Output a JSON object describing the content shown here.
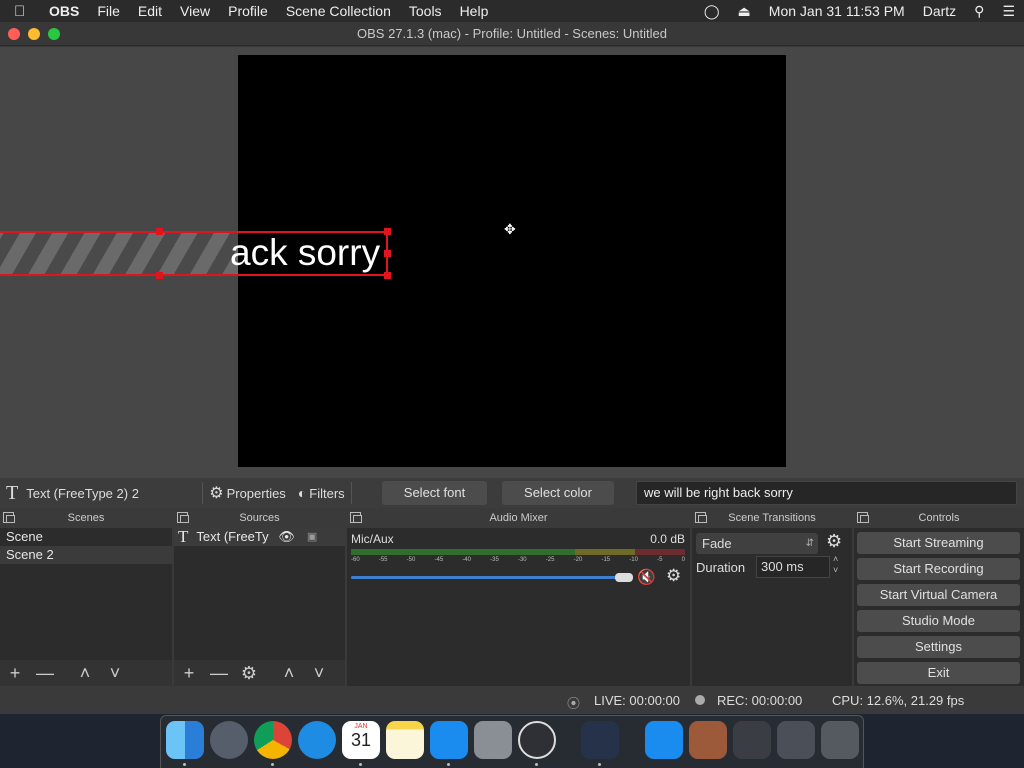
{
  "menubar": {
    "app_name": "OBS",
    "items": [
      "File",
      "Edit",
      "View",
      "Profile",
      "Scene Collection",
      "Tools",
      "Help"
    ],
    "clock": "Mon Jan 31  11:53 PM",
    "user": "Dartz"
  },
  "window": {
    "title": "OBS 27.1.3 (mac) - Profile: Untitled - Scenes: Untitled"
  },
  "preview": {
    "source_text": "ack sorry"
  },
  "source_toolbar": {
    "source_name": "Text (FreeType 2) 2",
    "properties_label": "Properties",
    "filters_label": "Filters",
    "select_font_label": "Select font",
    "select_color_label": "Select color",
    "text_value": "we will be right back sorry"
  },
  "scenes": {
    "title": "Scenes",
    "items": [
      "Scene",
      "Scene 2"
    ]
  },
  "sources": {
    "title": "Sources",
    "items": [
      "Text (FreeTy"
    ]
  },
  "audio_mixer": {
    "title": "Audio Mixer",
    "channel": "Mic/Aux",
    "level": "0.0 dB",
    "ticks": [
      "-60",
      "-55",
      "-50",
      "-45",
      "-40",
      "-35",
      "-30",
      "-25",
      "-20",
      "-15",
      "-10",
      "-5",
      "0"
    ],
    "volume": 0.97
  },
  "transitions": {
    "title": "Scene Transitions",
    "selected": "Fade",
    "duration_label": "Duration",
    "duration_value": "300 ms"
  },
  "controls": {
    "title": "Controls",
    "buttons": [
      "Start Streaming",
      "Start Recording",
      "Start Virtual Camera",
      "Studio Mode",
      "Settings",
      "Exit"
    ]
  },
  "status": {
    "live": "LIVE: 00:00:00",
    "rec": "REC: 00:00:00",
    "cpu": "CPU: 12.6%, 21.29 fps"
  },
  "dock": {
    "calendar_month": "JAN",
    "calendar_day": "31",
    "apps": [
      "finder-icon",
      "launchpad-icon",
      "chrome-icon",
      "safari-icon",
      "calendar-icon",
      "notes-icon",
      "app-store-icon",
      "system-preferences-icon",
      "obs-icon",
      "video-app-icon",
      "app-store-2-icon",
      "archive-icon",
      "screenshot-icon",
      "screenshot-2-icon",
      "trash-icon"
    ]
  }
}
